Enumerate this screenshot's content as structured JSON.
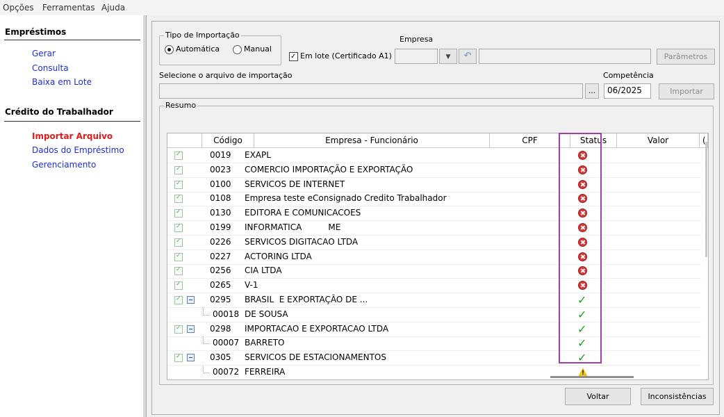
{
  "menu": [
    "Opções",
    "Ferramentas",
    "Ajuda"
  ],
  "sidebar": {
    "emprestimos_title": "Empréstimos",
    "emprestimos_links": [
      "Gerar",
      "Consulta",
      "Baixa em Lote"
    ],
    "credito_title": "Crédito do Trabalhador",
    "credito_links": [
      "Importar Arquivo",
      "Dados do Empréstimo",
      "Gerenciamento"
    ],
    "active_link": "Importar Arquivo"
  },
  "form": {
    "tipo_importacao_title": "Tipo de Importação",
    "radio_auto": "Automática",
    "radio_manual": "Manual",
    "selected_type": "Automática",
    "em_lote_label": "Em lote (Certificado A1)",
    "em_lote_checked": true,
    "empresa_label": "Empresa",
    "parametros_button": "Parâmetros",
    "arquivo_label": "Selecione o arquivo de importação",
    "browse_button": "...",
    "competencia_label": "Competência",
    "competencia_value": "06/2025",
    "importar_button": "Importar"
  },
  "resumo": {
    "title": "Resumo",
    "columns": [
      "Código",
      "Empresa - Funcionário",
      "CPF",
      "Status",
      "Valor",
      "("
    ],
    "rows": [
      {
        "code": "0019",
        "name": "EXAPL",
        "status": "error",
        "level": 0,
        "expandable": false
      },
      {
        "code": "0023",
        "name": "COMERCIO IMPORTAÇÃO E EXPORTAÇÃO",
        "status": "error",
        "level": 0,
        "expandable": false
      },
      {
        "code": "0100",
        "name": "SERVICOS DE INTERNET",
        "status": "error",
        "level": 0,
        "expandable": false
      },
      {
        "code": "0108",
        "name": "Empresa teste eConsignado Credito Trabalhador",
        "status": "error",
        "level": 0,
        "expandable": false
      },
      {
        "code": "0130",
        "name": "EDITORA E COMUNICACOES",
        "status": "error",
        "level": 0,
        "expandable": false
      },
      {
        "code": "0199",
        "name": "INFORMATICA          ME",
        "status": "error",
        "level": 0,
        "expandable": false
      },
      {
        "code": "0226",
        "name": "SERVICOS DIGITACAO LTDA",
        "status": "error",
        "level": 0,
        "expandable": false
      },
      {
        "code": "0227",
        "name": "ACTORING LTDA",
        "status": "error",
        "level": 0,
        "expandable": false
      },
      {
        "code": "0256",
        "name": "CIA LTDA",
        "status": "error",
        "level": 0,
        "expandable": false
      },
      {
        "code": "0265",
        "name": "V-1",
        "status": "error",
        "level": 0,
        "expandable": false
      },
      {
        "code": "0295",
        "name": "BRASIL  E EXPORTAÇÂO DE ...",
        "status": "ok",
        "level": 0,
        "expandable": true
      },
      {
        "code": "00018",
        "name": "DE SOUSA",
        "status": "ok",
        "level": 1,
        "expandable": false
      },
      {
        "code": "0298",
        "name": "IMPORTACAO E EXPORTACAO LTDA",
        "status": "ok",
        "level": 0,
        "expandable": true
      },
      {
        "code": "00007",
        "name": "BARRETO",
        "status": "ok",
        "level": 1,
        "expandable": false
      },
      {
        "code": "0305",
        "name": "SERVICOS DE ESTACIONAMENTOS",
        "status": "ok",
        "level": 0,
        "expandable": true
      },
      {
        "code": "00072",
        "name": "FERREIRA",
        "status": "warning",
        "level": 1,
        "expandable": false
      }
    ]
  },
  "footer": {
    "voltar_button": "Voltar",
    "inconsistencias_button": "Inconsistências"
  }
}
